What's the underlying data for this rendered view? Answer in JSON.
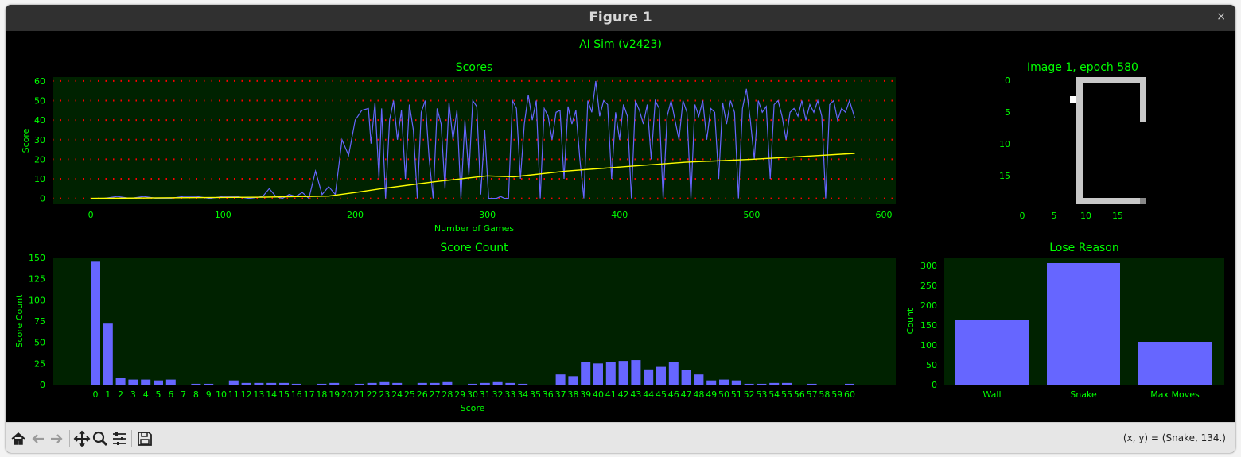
{
  "window": {
    "title": "Figure 1",
    "close_glyph": "×"
  },
  "figure_title": "AI Sim (v2423)",
  "toolbar": {
    "icons": [
      "home-icon",
      "back-arrow-icon",
      "forward-arrow-icon",
      "pan-icon",
      "zoom-icon",
      "configure-subplots-icon",
      "save-icon"
    ],
    "coord_readout": "(x, y) = (Snake, 134.)"
  },
  "colors": {
    "text": "#00ff00",
    "axes_bg": "#002200",
    "line": "#6666ff",
    "mean_line": "#ffff00",
    "grid": "#ff0000",
    "bar": "#6666ff",
    "board_body": "#c8c8c8",
    "board_food": "#ffffff"
  },
  "chart_data": [
    {
      "type": "line",
      "title": "Scores",
      "xlabel": "Number of Games",
      "ylabel": "Score",
      "xlim": [
        -29,
        609
      ],
      "ylim": [
        -3,
        62
      ],
      "xticks": [
        "0",
        "100",
        "200",
        "300",
        "400",
        "500",
        "600"
      ],
      "yticks": [
        "0",
        "10",
        "20",
        "30",
        "40",
        "50",
        "60"
      ],
      "grid": "dotted horizontal",
      "series": [
        {
          "style": "score",
          "x": [
            0,
            10,
            20,
            30,
            40,
            50,
            60,
            70,
            80,
            90,
            100,
            110,
            120,
            130,
            135,
            140,
            145,
            150,
            155,
            160,
            165,
            170,
            175,
            180,
            185,
            190,
            195,
            200,
            205,
            210,
            212,
            215,
            218,
            220,
            223,
            226,
            229,
            232,
            235,
            238,
            241,
            244,
            247,
            250,
            253,
            256,
            259,
            262,
            265,
            268,
            271,
            274,
            277,
            280,
            283,
            286,
            289,
            292,
            295,
            298,
            301,
            304,
            307,
            310,
            313,
            316,
            319,
            322,
            325,
            328,
            331,
            334,
            337,
            340,
            343,
            346,
            349,
            352,
            355,
            358,
            361,
            364,
            367,
            370,
            373,
            376,
            379,
            382,
            385,
            388,
            391,
            394,
            397,
            400,
            403,
            406,
            409,
            412,
            415,
            418,
            421,
            424,
            427,
            430,
            433,
            436,
            439,
            442,
            445,
            448,
            451,
            454,
            457,
            460,
            463,
            466,
            469,
            472,
            475,
            478,
            481,
            484,
            487,
            490,
            493,
            496,
            499,
            502,
            505,
            508,
            511,
            514,
            517,
            520,
            523,
            526,
            529,
            532,
            535,
            538,
            541,
            544,
            547,
            550,
            553,
            556,
            559,
            562,
            565,
            568,
            571,
            574,
            578
          ],
          "y": [
            0,
            0,
            1,
            0,
            1,
            0,
            0,
            1,
            1,
            0,
            1,
            1,
            0,
            1,
            5,
            1,
            0,
            2,
            1,
            3,
            0,
            14,
            2,
            6,
            2,
            30,
            22,
            40,
            45,
            46,
            28,
            49,
            10,
            46,
            0,
            40,
            50,
            30,
            45,
            10,
            48,
            35,
            0,
            44,
            50,
            20,
            0,
            46,
            38,
            5,
            49,
            30,
            45,
            0,
            40,
            12,
            50,
            47,
            2,
            35,
            0,
            0,
            0,
            1,
            0,
            0,
            50,
            46,
            10,
            38,
            53,
            40,
            50,
            0,
            46,
            42,
            30,
            44,
            45,
            10,
            47,
            38,
            45,
            20,
            0,
            50,
            44,
            60,
            42,
            50,
            48,
            10,
            44,
            30,
            48,
            42,
            0,
            50,
            45,
            38,
            48,
            20,
            50,
            46,
            0,
            42,
            50,
            40,
            30,
            50,
            44,
            0,
            48,
            42,
            50,
            30,
            46,
            44,
            10,
            49,
            38,
            50,
            44,
            0,
            46,
            56,
            40,
            20,
            50,
            44,
            47,
            10,
            48,
            50,
            42,
            30,
            44,
            46,
            42,
            50,
            40,
            48,
            44,
            50,
            42,
            0,
            48,
            50,
            40,
            46,
            44,
            50,
            41
          ]
        },
        {
          "style": "mean",
          "x": [
            0,
            100,
            130,
            180,
            200,
            220,
            260,
            300,
            320,
            360,
            400,
            450,
            500,
            540,
            578
          ],
          "y": [
            0,
            0.5,
            0.6,
            1.2,
            3,
            5,
            8.5,
            11.5,
            11,
            14,
            16,
            18.5,
            20,
            21.5,
            23
          ]
        }
      ]
    },
    {
      "type": "image",
      "title": "Image 1, epoch 580",
      "xticks": [
        "0",
        "5",
        "10",
        "15"
      ],
      "yticks": [
        "0",
        "5",
        "10",
        "15"
      ],
      "grid_size": [
        20,
        20
      ],
      "food": [
        [
          8,
          3
        ]
      ],
      "snake_cells": [
        [
          9,
          0
        ],
        [
          10,
          0
        ],
        [
          11,
          0
        ],
        [
          12,
          0
        ],
        [
          13,
          0
        ],
        [
          14,
          0
        ],
        [
          15,
          0
        ],
        [
          16,
          0
        ],
        [
          17,
          0
        ],
        [
          18,
          0
        ],
        [
          19,
          0
        ],
        [
          19,
          1
        ],
        [
          19,
          2
        ],
        [
          19,
          3
        ],
        [
          19,
          4
        ],
        [
          19,
          5
        ],
        [
          19,
          6
        ],
        [
          9,
          1
        ],
        [
          9,
          2
        ],
        [
          9,
          3
        ],
        [
          9,
          4
        ],
        [
          9,
          5
        ],
        [
          9,
          6
        ],
        [
          9,
          7
        ],
        [
          9,
          8
        ],
        [
          9,
          9
        ],
        [
          9,
          10
        ],
        [
          9,
          11
        ],
        [
          9,
          12
        ],
        [
          9,
          13
        ],
        [
          9,
          14
        ],
        [
          9,
          15
        ],
        [
          9,
          16
        ],
        [
          9,
          17
        ],
        [
          9,
          18
        ],
        [
          9,
          19
        ],
        [
          10,
          19
        ],
        [
          11,
          19
        ],
        [
          12,
          19
        ],
        [
          13,
          19
        ],
        [
          14,
          19
        ],
        [
          15,
          19
        ],
        [
          16,
          19
        ],
        [
          17,
          19
        ],
        [
          18,
          19
        ],
        [
          19,
          19
        ]
      ],
      "snake_head": [
        19,
        19
      ]
    },
    {
      "type": "bar",
      "title": "Score Count",
      "xlabel": "Score",
      "ylabel": "Score Count",
      "ylim": [
        0,
        150
      ],
      "yticks": [
        "0",
        "25",
        "50",
        "75",
        "100",
        "125",
        "150"
      ],
      "categories": [
        "0",
        "1",
        "2",
        "3",
        "4",
        "5",
        "6",
        "7",
        "8",
        "9",
        "10",
        "11",
        "12",
        "13",
        "14",
        "15",
        "16",
        "17",
        "18",
        "19",
        "20",
        "21",
        "22",
        "23",
        "24",
        "25",
        "26",
        "27",
        "28",
        "29",
        "30",
        "31",
        "32",
        "33",
        "34",
        "35",
        "36",
        "37",
        "38",
        "39",
        "40",
        "41",
        "42",
        "43",
        "44",
        "45",
        "46",
        "47",
        "48",
        "49",
        "50",
        "51",
        "52",
        "53",
        "54",
        "55",
        "56",
        "57",
        "58",
        "59",
        "60"
      ],
      "values": [
        145,
        72,
        8,
        6,
        6,
        5,
        6,
        0,
        1,
        1,
        0,
        5,
        2,
        2,
        2,
        2,
        1,
        0,
        1,
        2,
        0,
        1,
        2,
        3,
        2,
        0,
        2,
        2,
        3,
        0,
        1,
        2,
        3,
        2,
        1,
        0,
        0,
        12,
        10,
        27,
        25,
        27,
        28,
        29,
        18,
        21,
        27,
        17,
        12,
        5,
        6,
        5,
        1,
        1,
        2,
        2,
        0,
        1,
        0,
        0,
        1
      ]
    },
    {
      "type": "bar",
      "title": "Lose Reason",
      "ylabel": "Count",
      "ylim": [
        0,
        320
      ],
      "yticks": [
        "0",
        "50",
        "100",
        "150",
        "200",
        "250",
        "300"
      ],
      "categories": [
        "Wall",
        "Snake",
        "Max Moves"
      ],
      "values": [
        162,
        306,
        108
      ]
    }
  ]
}
